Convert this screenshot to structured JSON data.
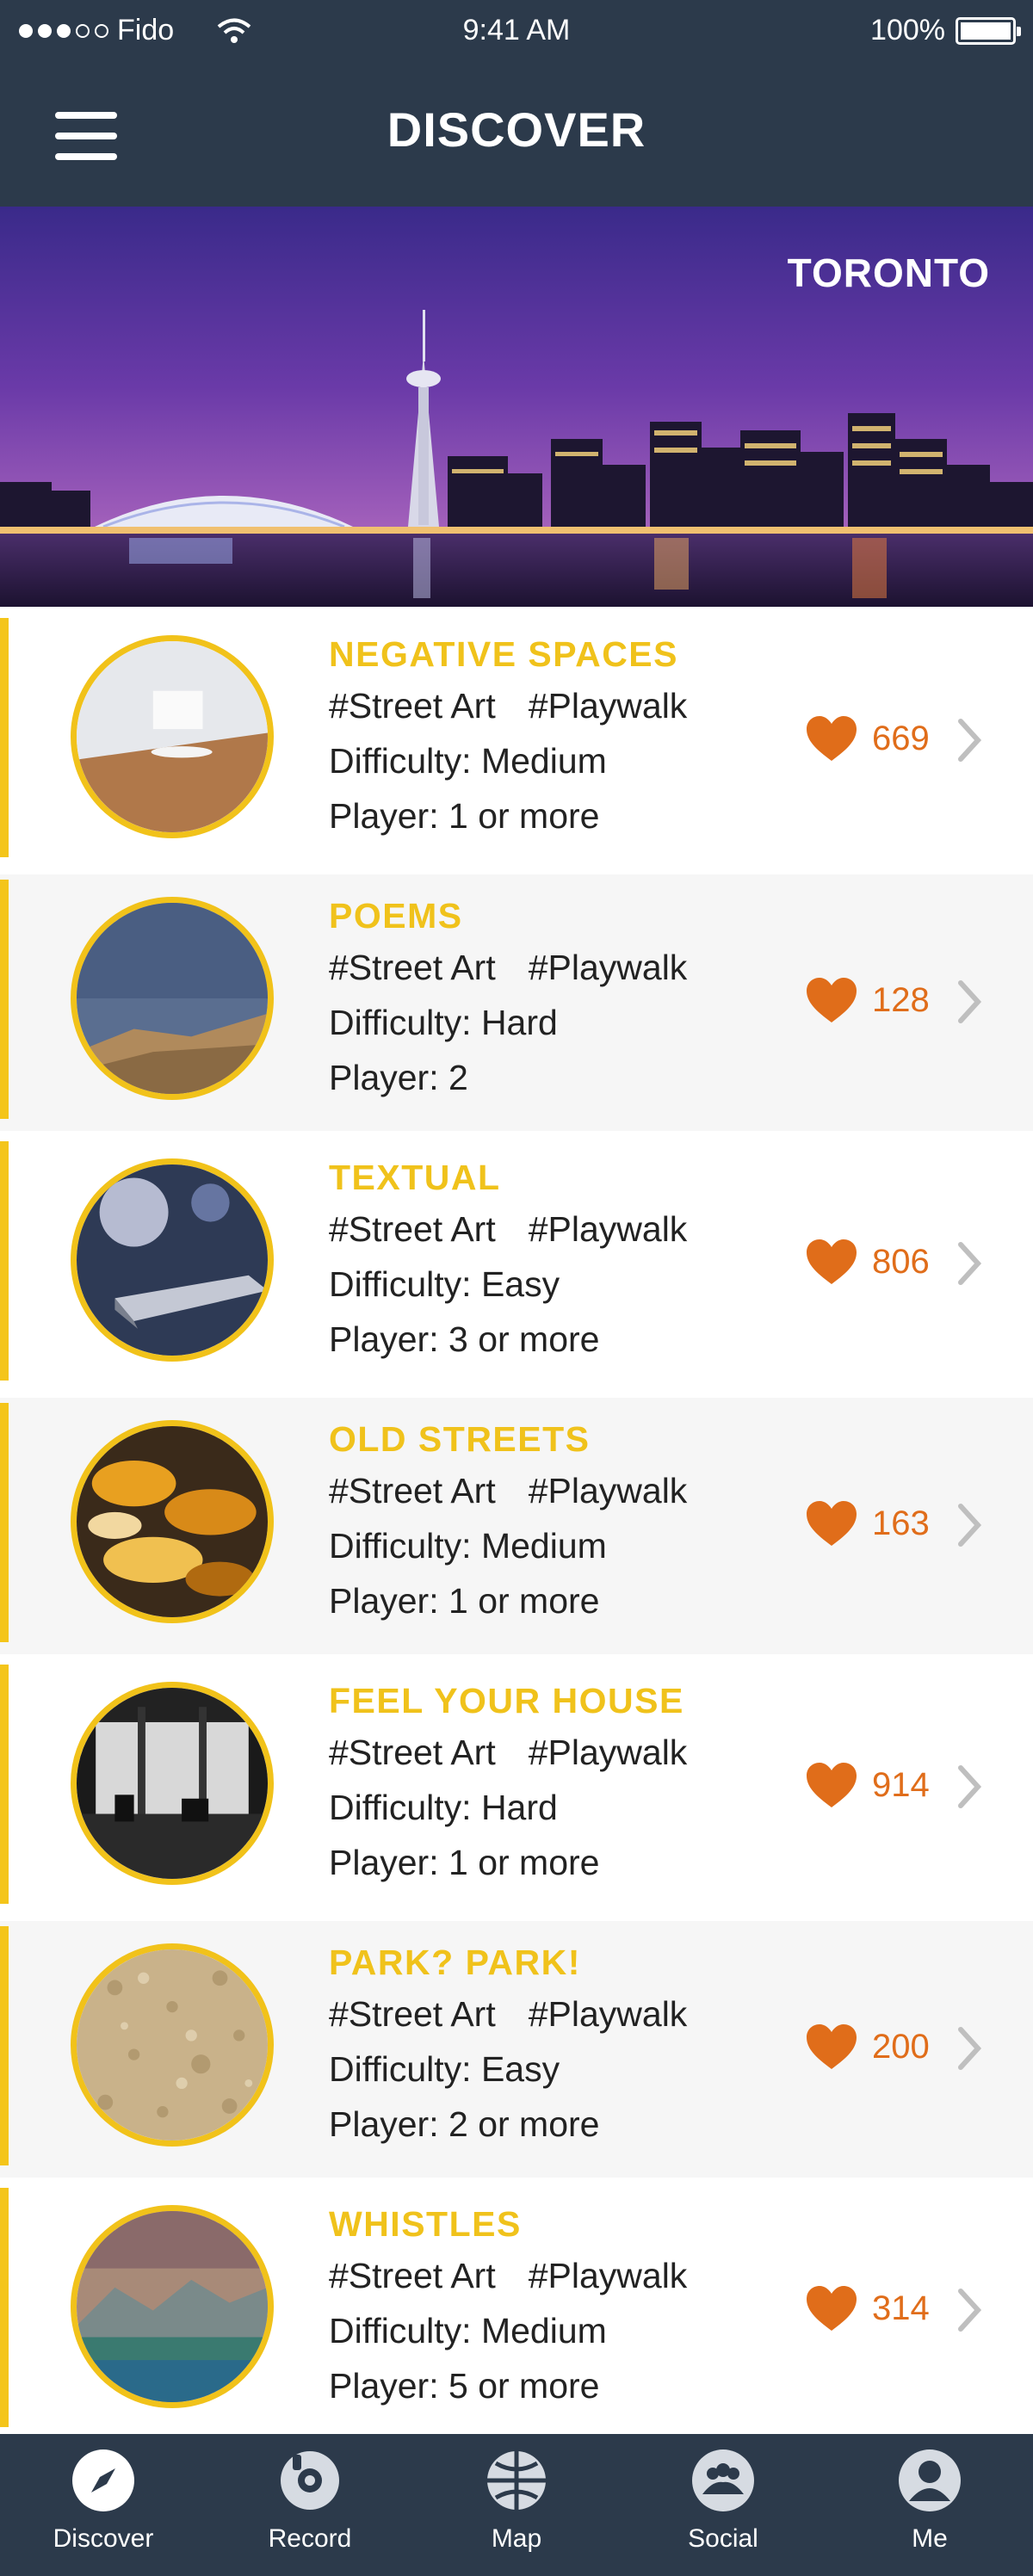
{
  "status_bar": {
    "carrier": "Fido",
    "time": "9:41 AM",
    "battery": "100%"
  },
  "header": {
    "title": "DISCOVER"
  },
  "hero": {
    "city": "TORONTO"
  },
  "walks": [
    {
      "title": "NEGATIVE SPACES",
      "tags": [
        "#Street Art",
        "#Playwalk"
      ],
      "difficulty": "Difficulty: Medium",
      "players": "Player: 1 or more",
      "likes": "669"
    },
    {
      "title": "POEMS",
      "tags": [
        "#Street Art",
        "#Playwalk"
      ],
      "difficulty": "Difficulty: Hard",
      "players": "Player: 2",
      "likes": "128"
    },
    {
      "title": "TEXTUAL",
      "tags": [
        "#Street Art",
        "#Playwalk"
      ],
      "difficulty": "Difficulty: Easy",
      "players": "Player: 3 or more",
      "likes": "806"
    },
    {
      "title": "OLD STREETS",
      "tags": [
        "#Street Art",
        "#Playwalk"
      ],
      "difficulty": "Difficulty: Medium",
      "players": "Player: 1 or more",
      "likes": "163"
    },
    {
      "title": "FEEL YOUR HOUSE",
      "tags": [
        "#Street Art",
        "#Playwalk"
      ],
      "difficulty": "Difficulty: Hard",
      "players": "Player: 1 or more",
      "likes": "914"
    },
    {
      "title": "PARK? PARK!",
      "tags": [
        "#Street Art",
        "#Playwalk"
      ],
      "difficulty": "Difficulty: Easy",
      "players": "Player: 2 or more",
      "likes": "200"
    },
    {
      "title": "WHISTLES",
      "tags": [
        "#Street Art",
        "#Playwalk"
      ],
      "difficulty": "Difficulty: Medium",
      "players": "Player: 5 or more",
      "likes": "314"
    }
  ],
  "tabs": [
    {
      "label": "Discover",
      "icon": "compass-icon"
    },
    {
      "label": "Record",
      "icon": "record-icon"
    },
    {
      "label": "Map",
      "icon": "globe-icon"
    },
    {
      "label": "Social",
      "icon": "group-icon"
    },
    {
      "label": "Me",
      "icon": "user-icon"
    }
  ],
  "colors": {
    "header_bg": "#2c3a4b",
    "accent_yellow": "#f0c21b",
    "like_orange": "#e06d1a"
  }
}
